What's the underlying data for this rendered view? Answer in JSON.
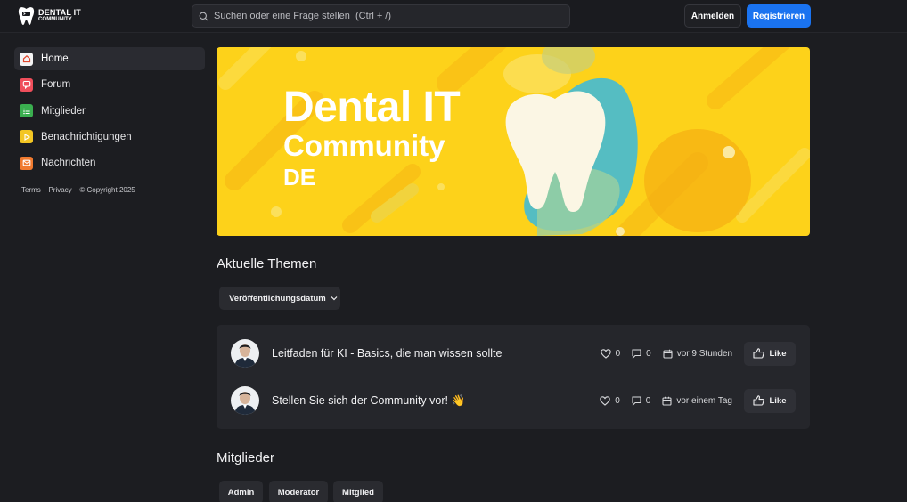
{
  "header": {
    "logo_line1": "DENTAL IT",
    "logo_line2": "COMMUNITY",
    "search_placeholder": "Suchen oder eine Frage stellen  (Ctrl + /)",
    "login_label": "Anmelden",
    "register_label": "Registrieren"
  },
  "sidebar": {
    "items": [
      {
        "label": "Home",
        "icon": "home-icon",
        "color": "#f4f4f5",
        "active": true
      },
      {
        "label": "Forum",
        "icon": "forum-icon",
        "color": "#ef4e5b"
      },
      {
        "label": "Mitglieder",
        "icon": "members-icon",
        "color": "#3aae4f"
      },
      {
        "label": "Benachrichtigungen",
        "icon": "notifications-icon",
        "color": "#f3c623"
      },
      {
        "label": "Nachrichten",
        "icon": "messages-icon",
        "color": "#f07a2f"
      }
    ],
    "footer": {
      "terms": "Terms",
      "sep1": "·",
      "privacy": "Privacy",
      "sep2": "·",
      "copyright": "© Copyright 2025"
    }
  },
  "banner": {
    "line1": "Dental IT",
    "line2": "Community",
    "line3": "DE",
    "bg_color": "#fdd21a"
  },
  "topics_section": {
    "title": "Aktuelle Themen",
    "sort_label": "Veröffentlichungsdatum",
    "topics": [
      {
        "title": "Leitfaden für KI - Basics, die man wissen sollte",
        "likes": "0",
        "comments": "0",
        "time": "vor 9 Stunden",
        "like_label": "Like"
      },
      {
        "title": "Stellen Sie sich der Community vor! 👋",
        "likes": "0",
        "comments": "0",
        "time": "vor einem Tag",
        "like_label": "Like"
      }
    ]
  },
  "members_section": {
    "title": "Mitglieder",
    "roles": [
      "Admin",
      "Moderator",
      "Mitglied"
    ]
  },
  "colors": {
    "accent": "#1a73f0",
    "background": "#1c1d21",
    "card": "#25262b"
  }
}
